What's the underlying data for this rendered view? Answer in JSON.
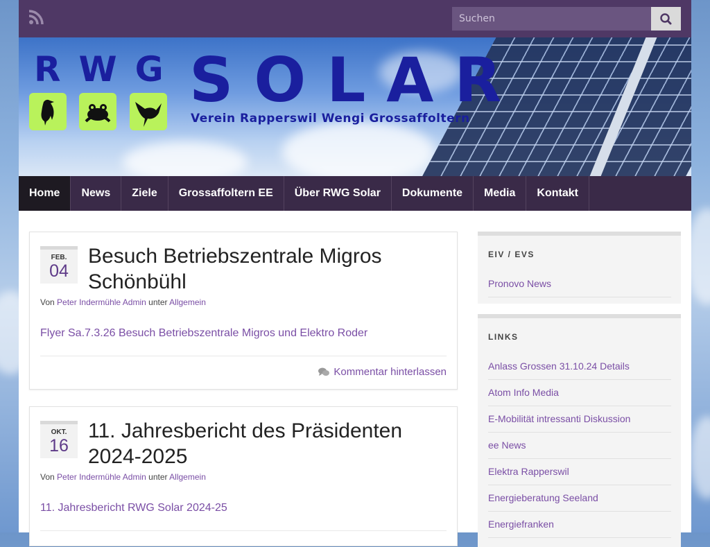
{
  "topbar": {
    "rss_icon": "rss-icon",
    "search_placeholder": "Suchen",
    "search_icon": "search-icon"
  },
  "banner": {
    "rwg": "RWG",
    "solar": "SOLAR",
    "tagline": "Verein Rapperswil Wengi Grossaffoltern",
    "animals": [
      "crow-icon",
      "frog-icon",
      "heron-icon"
    ]
  },
  "nav": {
    "items": [
      {
        "label": "Home"
      },
      {
        "label": "News"
      },
      {
        "label": "Ziele"
      },
      {
        "label": "Grossaffoltern EE"
      },
      {
        "label": "Über RWG Solar"
      },
      {
        "label": "Dokumente"
      },
      {
        "label": "Media"
      },
      {
        "label": "Kontakt"
      }
    ]
  },
  "posts": [
    {
      "month": "FEB.",
      "day": "04",
      "title": "Besuch Betriebszentrale Migros Schönbühl",
      "by": "Von",
      "author": "Peter Indermühle Admin",
      "under": "unter",
      "category": "Allgemein",
      "excerpt": "Flyer Sa.7.3.26 Besuch Betriebszentrale Migros und Elektro Roder",
      "comment": "Kommentar hinterlassen"
    },
    {
      "month": "OKT.",
      "day": "16",
      "title": "11. Jahresbericht des Präsidenten 2024-2025",
      "by": "Von",
      "author": "Peter Indermühle Admin",
      "under": "unter",
      "category": "Allgemein",
      "excerpt": "11. Jahresbericht RWG Solar 2024-25"
    }
  ],
  "sidebar": {
    "eiv": {
      "title": "EIV / EVS",
      "links": [
        "Pronovo News"
      ]
    },
    "links": {
      "title": "LINKS",
      "links": [
        "Anlass Grossen 31.10.24 Details",
        "Atom Info Media",
        "E-Mobilität intressanti Diskussion",
        "ee News",
        "Elektra Rapperswil",
        "Energieberatung Seeland",
        "Energiefranken"
      ]
    }
  },
  "colors": {
    "topbar": "#4f3865",
    "nav": "#3a2a48",
    "accent": "#7a4ea5",
    "logo_blue": "#1a1f9e",
    "logo_green": "#b9f25b"
  }
}
